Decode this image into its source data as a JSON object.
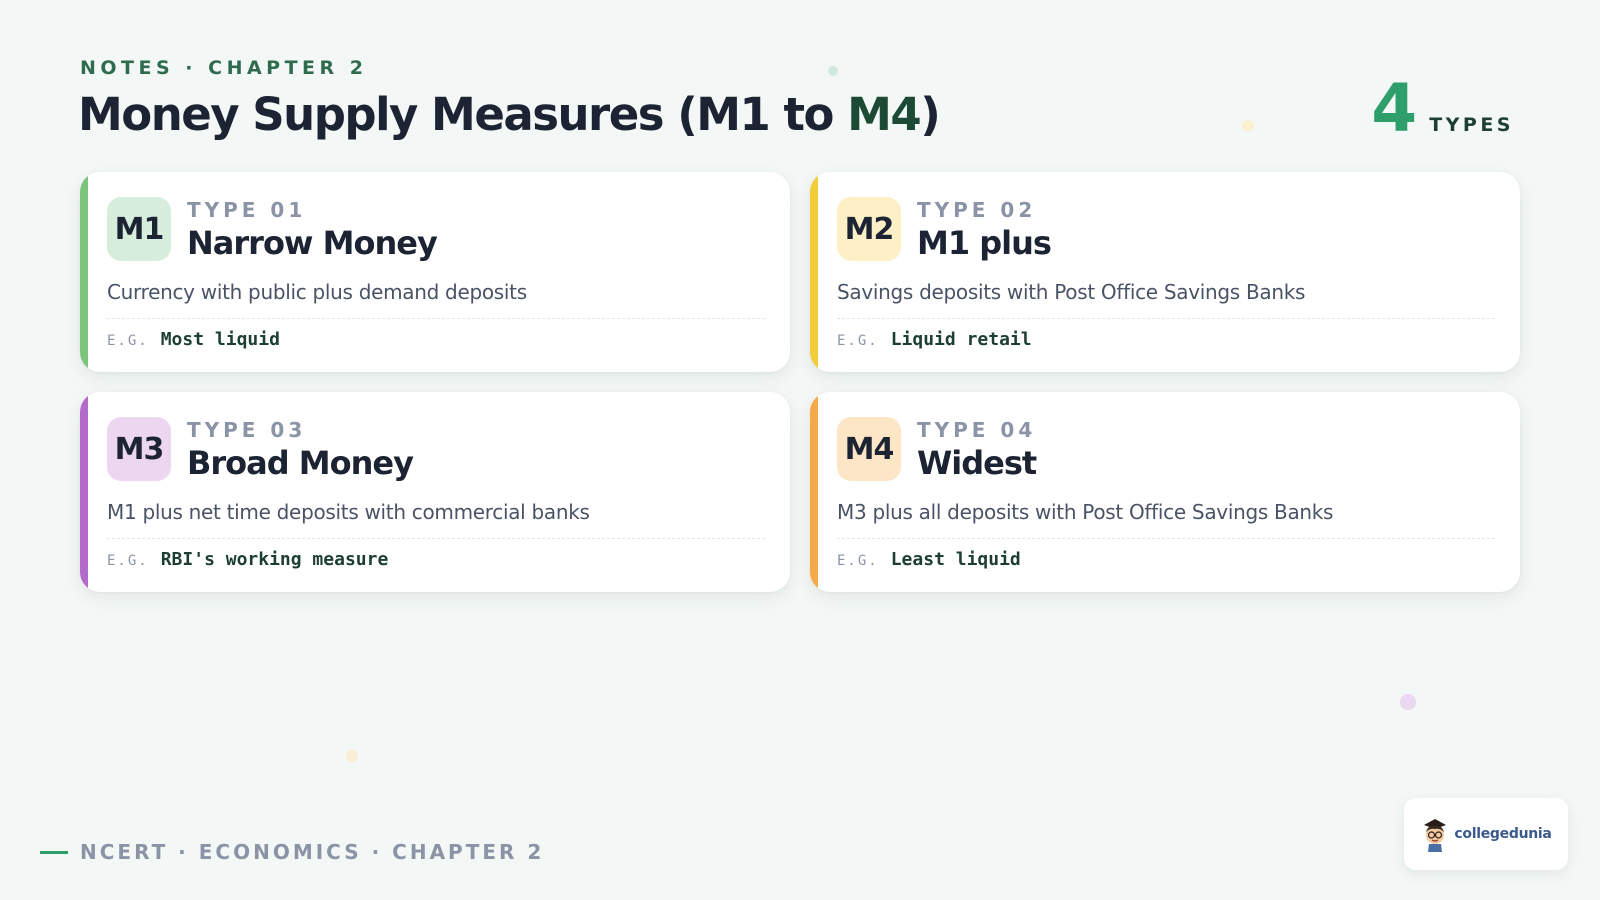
{
  "header": {
    "kicker": "NOTES · CHAPTER 2",
    "title_main": "Money Supply Measures (M1 to ",
    "title_accent": "M4",
    "title_close": ")",
    "count_value": "4",
    "count_label": "TYPES"
  },
  "cards": [
    {
      "badge": "M1",
      "type_label": "TYPE 01",
      "name": "Narrow Money",
      "description": "Currency with public plus demand deposits",
      "eg_label": "E.G.",
      "eg_value": "Most liquid",
      "accent_color": "#7cc47c",
      "badge_color": "#d6eedb"
    },
    {
      "badge": "M2",
      "type_label": "TYPE 02",
      "name": "M1 plus",
      "description": "Savings deposits with Post Office Savings Banks",
      "eg_label": "E.G.",
      "eg_value": "Liquid retail",
      "accent_color": "#f2cc3a",
      "badge_color": "#fdf0c6"
    },
    {
      "badge": "M3",
      "type_label": "TYPE 03",
      "name": "Broad Money",
      "description": "M1 plus net time deposits with commercial banks",
      "eg_label": "E.G.",
      "eg_value": "RBI's working measure",
      "accent_color": "#b36bc9",
      "badge_color": "#ecd6f0"
    },
    {
      "badge": "M4",
      "type_label": "TYPE 04",
      "name": "Widest",
      "description": "M3 plus all deposits with Post Office Savings Banks",
      "eg_label": "E.G.",
      "eg_value": "Least liquid",
      "accent_color": "#f5a94a",
      "badge_color": "#fde6c6"
    }
  ],
  "footer": {
    "text": "NCERT · ECONOMICS · CHAPTER 2"
  },
  "logo": {
    "brand": "collegedunia",
    "icon": "student-mascot-icon"
  }
}
